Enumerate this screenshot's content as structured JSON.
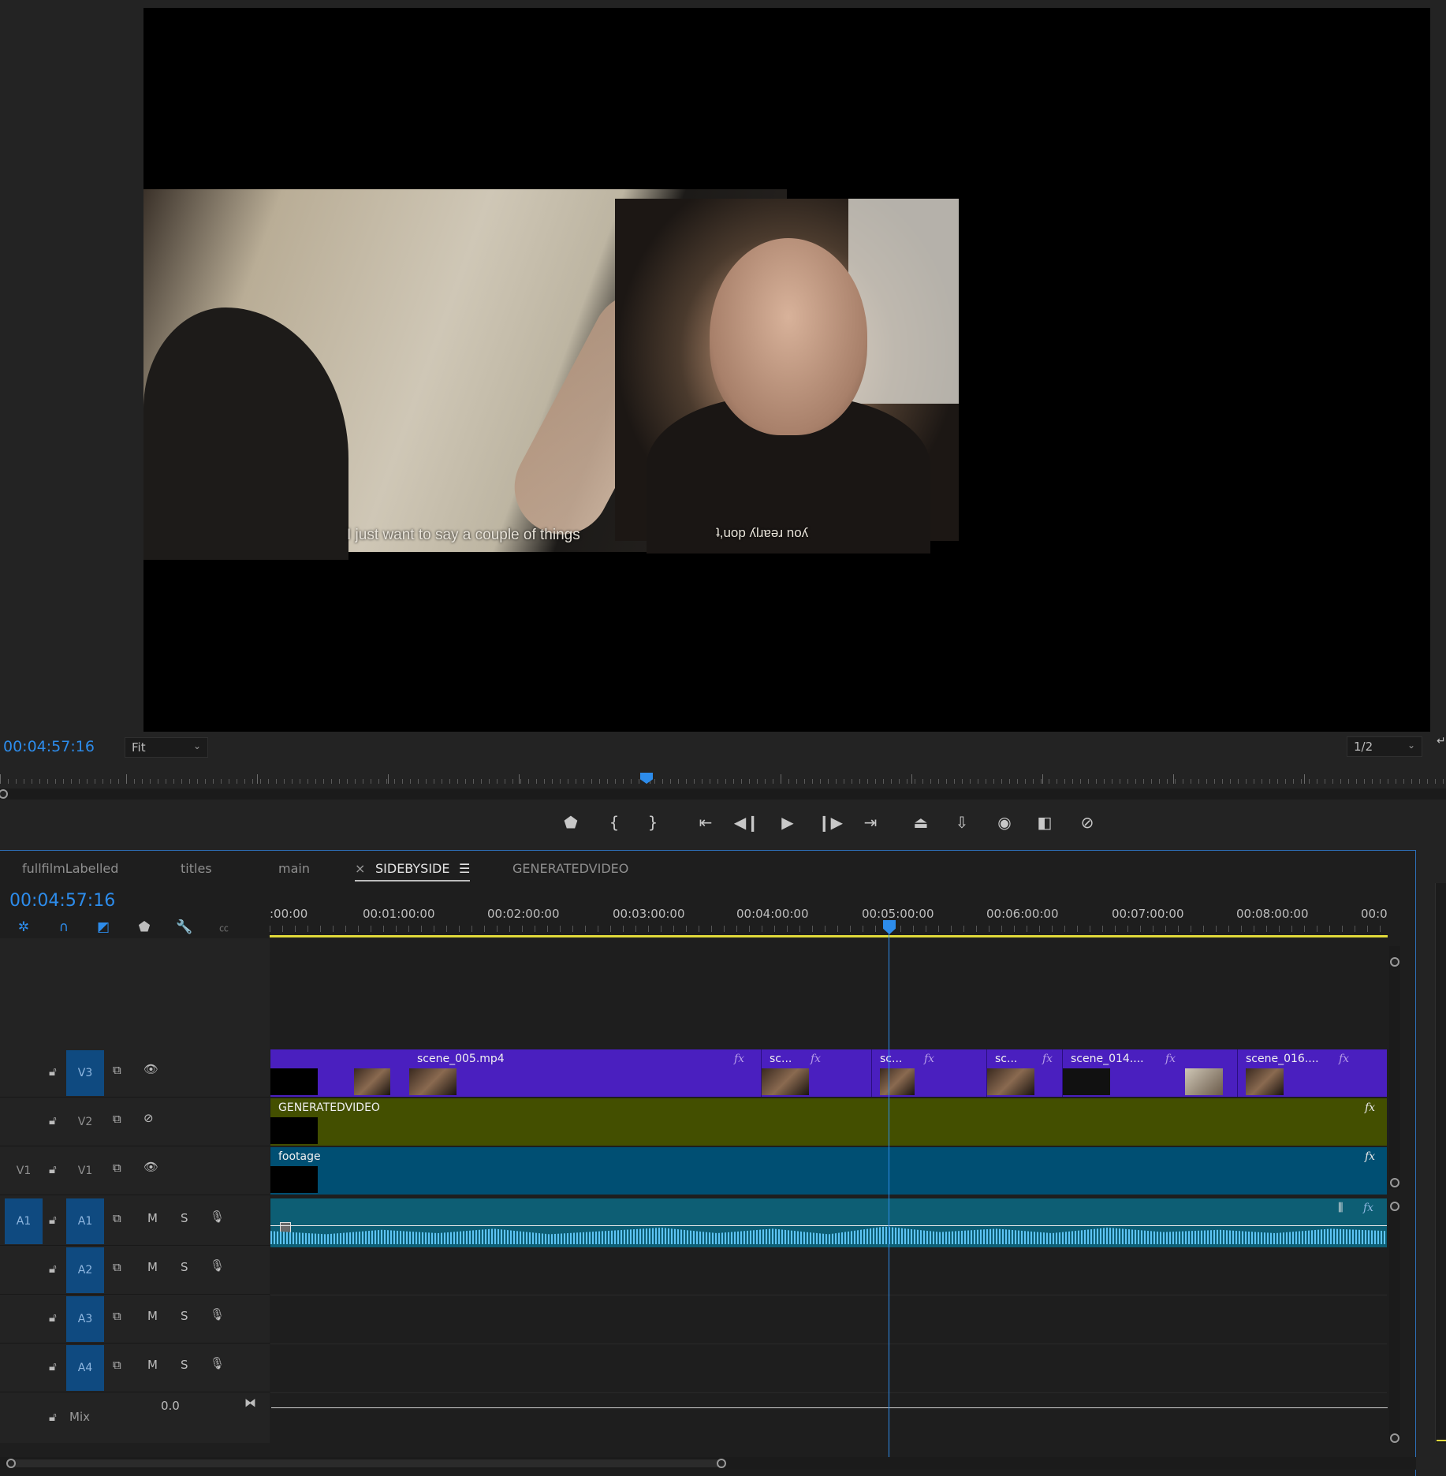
{
  "monitor": {
    "timecode": "00:04:57:16",
    "zoom": "Fit",
    "resolution": "1/2",
    "subtitle_left": "I just want to say a couple of things",
    "subtitle_right": "ʇ,uop ʎlɹɐǝɹ noʎ",
    "accent_color": "#2d8ceb"
  },
  "transport_icons": [
    "add-marker-icon",
    "mark-in-icon",
    "mark-out-icon",
    "go-to-in-icon",
    "step-back-icon",
    "play-icon",
    "step-forward-icon",
    "go-to-out-icon",
    "lift-icon",
    "extract-icon",
    "export-frame-icon",
    "comparison-view-icon",
    "toggle-proxies-icon"
  ],
  "timeline": {
    "tabs": [
      {
        "label": "fullfilmLabelled"
      },
      {
        "label": "titles"
      },
      {
        "label": "main"
      },
      {
        "label": "SIDEBYSIDE",
        "close": "×",
        "menu": "☰"
      },
      {
        "label": "GENERATEDVIDEO"
      }
    ],
    "timecode": "00:04:57:16",
    "ruler_labels": [
      ":00:00",
      "00:01:00:00",
      "00:02:00:00",
      "00:03:00:00",
      "00:04:00:00",
      "00:05:00:00",
      "00:06:00:00",
      "00:07:00:00",
      "00:08:00:00",
      "00:0"
    ],
    "tracks": {
      "v3": {
        "target": "V3"
      },
      "v2": {
        "target": "V2"
      },
      "v1": {
        "source": "V1",
        "target": "V1"
      },
      "a1": {
        "source": "A1",
        "target": "A1",
        "m": "M",
        "s": "S"
      },
      "a2": {
        "target": "A2",
        "m": "M",
        "s": "S"
      },
      "a3": {
        "target": "A3",
        "m": "M",
        "s": "S"
      },
      "a4": {
        "target": "A4",
        "m": "M",
        "s": "S"
      },
      "mix": {
        "label": "Mix",
        "value": "0.0"
      }
    },
    "clips": {
      "v3": [
        "scene_005.mp4",
        "sc...",
        "sc...",
        "sc...",
        "scene_014....",
        "scene_016...."
      ],
      "v2": "GENERATEDVIDEO",
      "v1": "footage",
      "fx": "fx"
    },
    "colors": {
      "v3_clip": "#4a1fbf",
      "v2_clip": "#434f00",
      "v1_clip": "#004f73",
      "audio_clip": "#0d5e74",
      "waveform": "#5ec4f5",
      "work_area": "#e0d93a"
    }
  }
}
